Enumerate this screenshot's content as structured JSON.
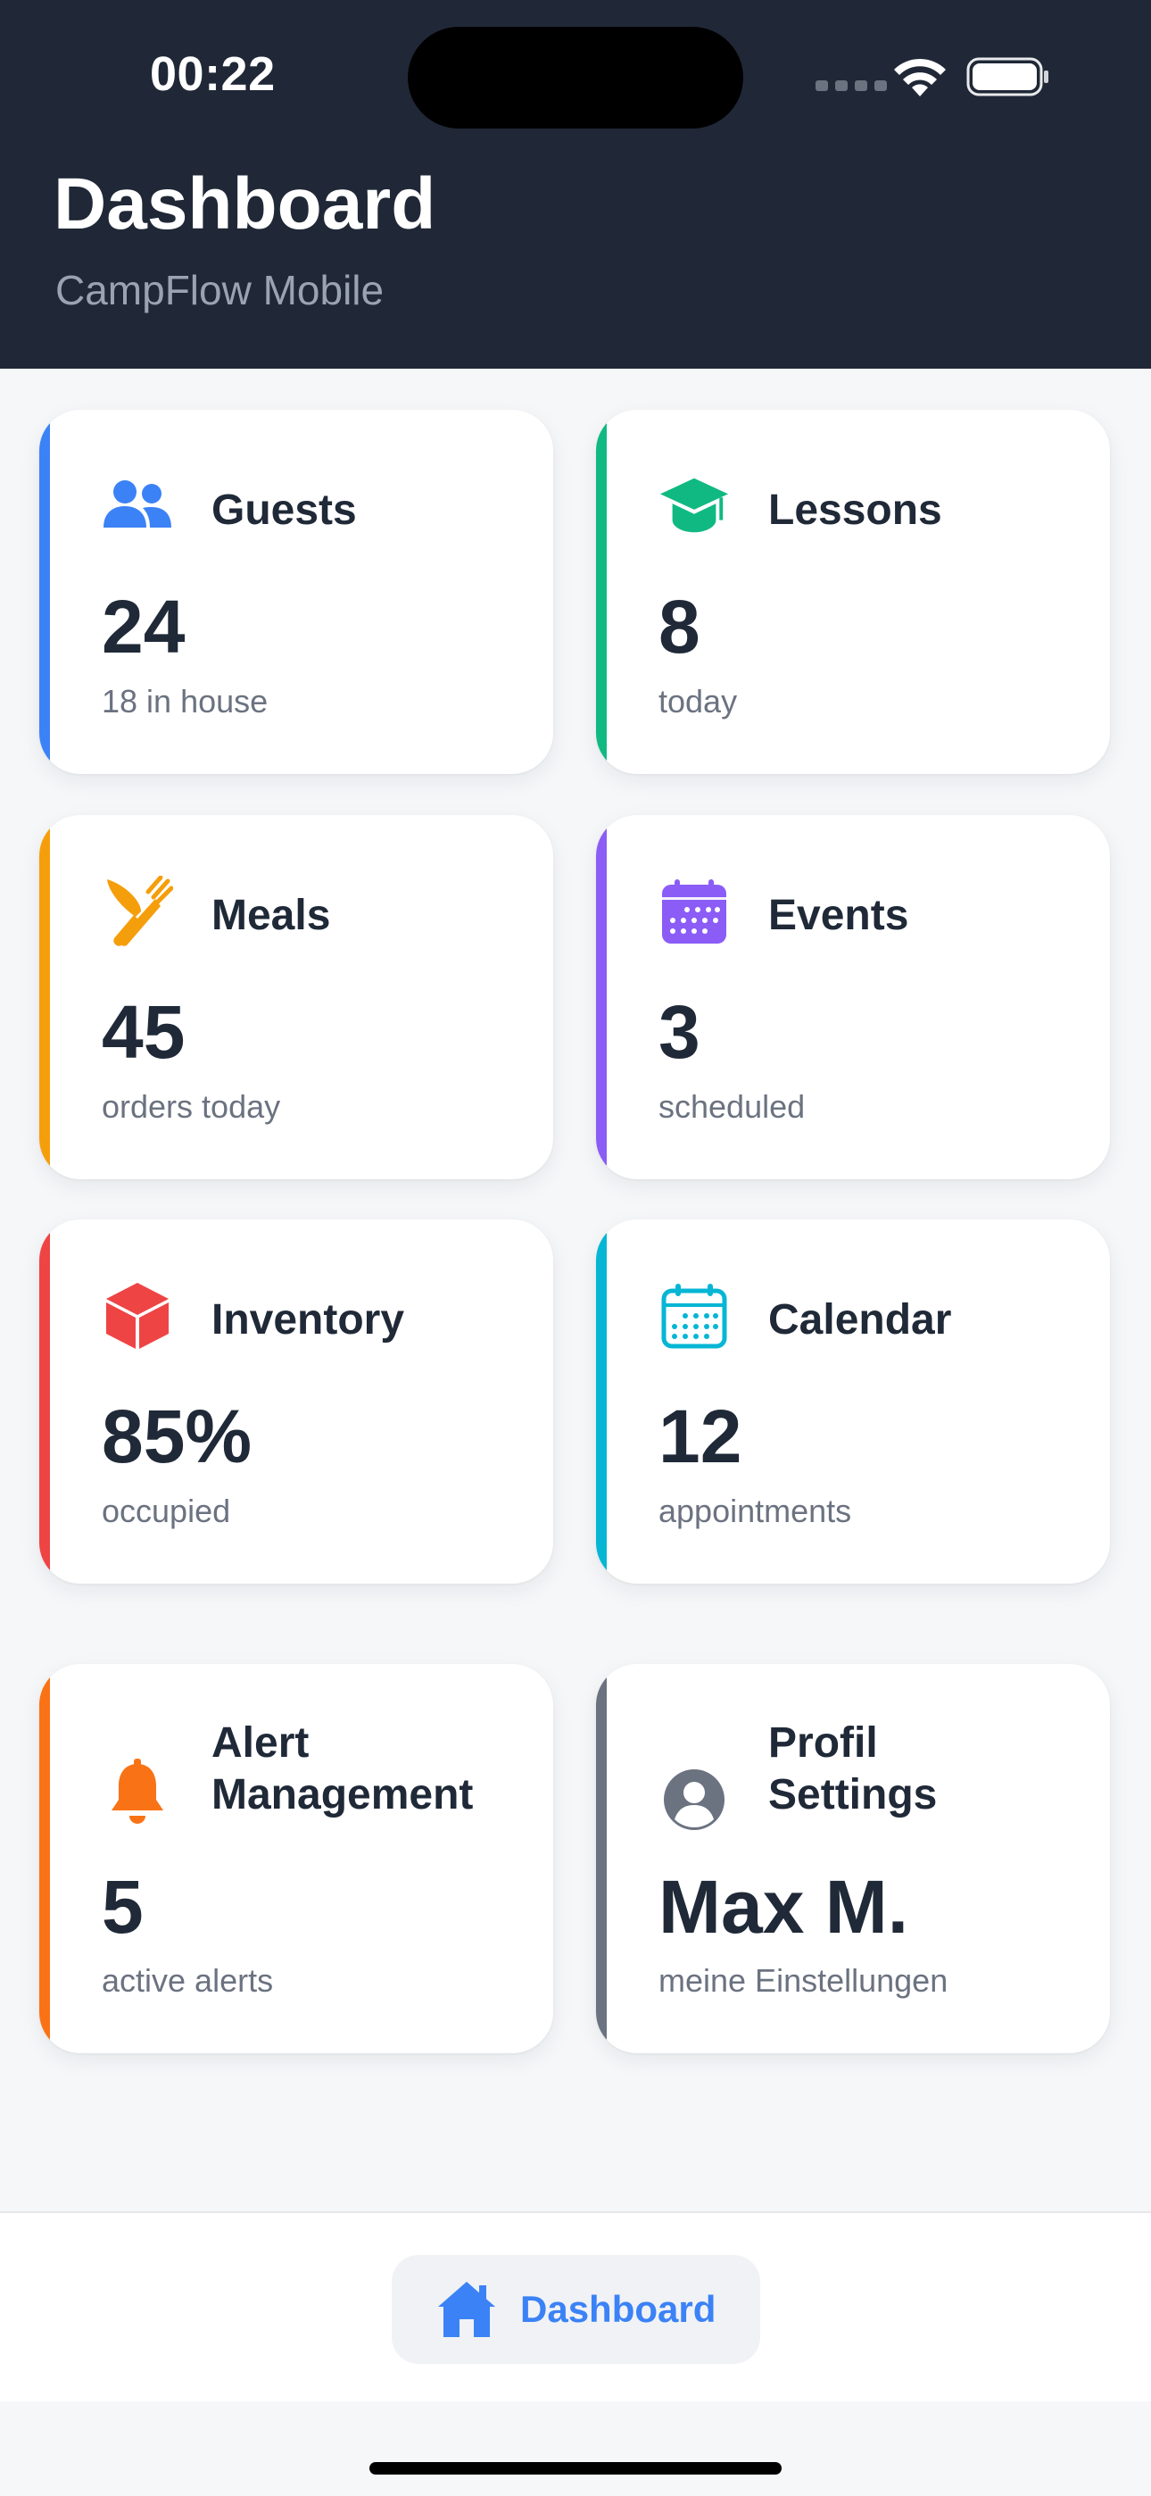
{
  "status_bar": {
    "time": "00:22"
  },
  "header": {
    "title": "Dashboard",
    "subtitle": "CampFlow Mobile"
  },
  "cards": [
    {
      "id": "guests",
      "title": "Guests",
      "value": "24",
      "caption": "18 in house",
      "accent": "#3b82f6",
      "icon": "users-icon"
    },
    {
      "id": "lessons",
      "title": "Lessons",
      "value": "8",
      "caption": "today",
      "accent": "#10b981",
      "icon": "graduation-cap-icon"
    },
    {
      "id": "meals",
      "title": "Meals",
      "value": "45",
      "caption": "orders today",
      "accent": "#f59e0b",
      "icon": "utensils-icon"
    },
    {
      "id": "events",
      "title": "Events",
      "value": "3",
      "caption": "scheduled",
      "accent": "#8b5cf6",
      "icon": "calendar-filled-icon"
    },
    {
      "id": "inventory",
      "title": "Inventory",
      "value": "85%",
      "caption": "occupied",
      "accent": "#ef4444",
      "icon": "cube-icon"
    },
    {
      "id": "calendar",
      "title": "Calendar",
      "value": "12",
      "caption": "appointments",
      "accent": "#06b6d4",
      "icon": "calendar-outline-icon"
    },
    {
      "id": "alerts",
      "title_line1": "Alert",
      "title_line2": "Management",
      "value": "5",
      "caption": "active alerts",
      "accent": "#f97316",
      "icon": "bell-icon"
    },
    {
      "id": "profile",
      "title_line1": "Profil",
      "title_line2": "Settings",
      "value": "Max M.",
      "caption": "meine Einstellungen",
      "accent": "#6b7280",
      "icon": "user-circle-icon"
    }
  ],
  "bottom_nav": {
    "active_label": "Dashboard",
    "icon": "home-icon",
    "accent": "#3b82f6"
  }
}
